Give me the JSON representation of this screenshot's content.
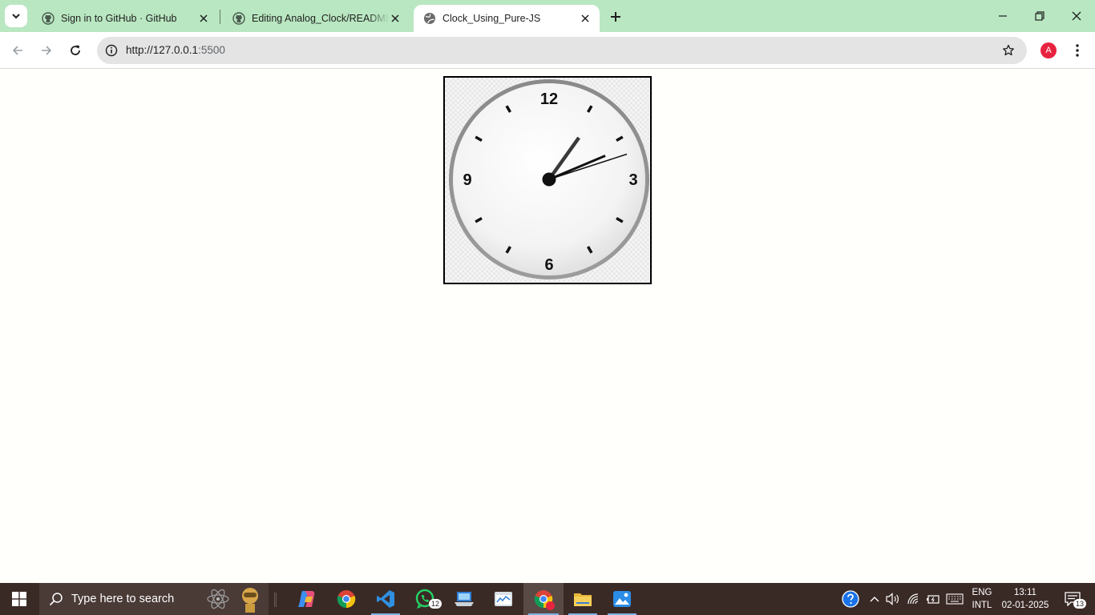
{
  "browser": {
    "tabs": [
      {
        "title": "Sign in to GitHub · GitHub",
        "icon": "github-icon",
        "active": false
      },
      {
        "title": "Editing Analog_Clock/README.md",
        "icon": "github-icon",
        "active": false
      },
      {
        "title": "Clock_Using_Pure-JS",
        "icon": "globe-icon",
        "active": true
      }
    ],
    "url_host": "http://127.0.0.1",
    "url_port": ":5500",
    "profile_initial": "A"
  },
  "page": {
    "clock": {
      "numerals": {
        "twelve": "12",
        "three": "3",
        "six": "6",
        "nine": "9"
      },
      "time": {
        "hour": 1,
        "minute": 11,
        "second": 12
      }
    }
  },
  "taskbar": {
    "search_placeholder": "Type here to search",
    "whatsapp_badge": "12",
    "language_line1": "ENG",
    "language_line2": "INTL",
    "time": "13:11",
    "date": "02-01-2025",
    "notification_count": "13"
  },
  "colors": {
    "tabstrip": "#b9e7c1",
    "taskbar": "#3a2a26",
    "profile": "#e8233f"
  }
}
